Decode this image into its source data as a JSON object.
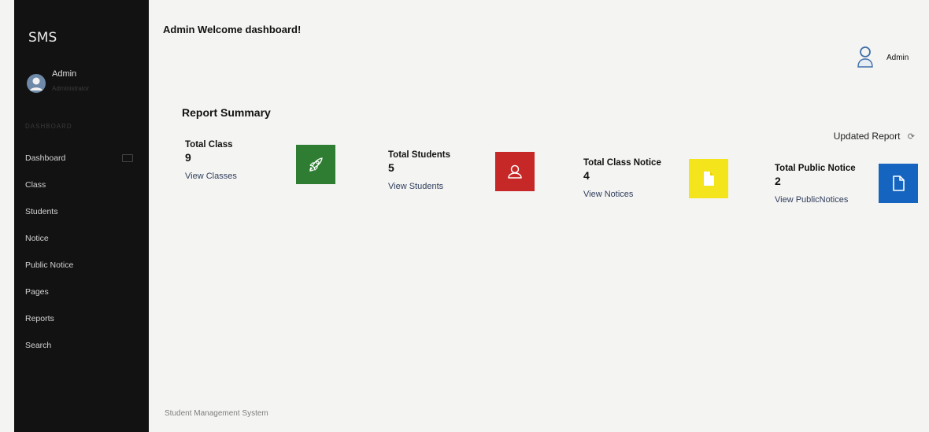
{
  "sidebar": {
    "brand": "SMS",
    "user": {
      "name": "Admin",
      "subtitle": "Administrator"
    },
    "section_label": "DASHBOARD",
    "items": [
      {
        "label": "Dashboard",
        "icon": "monitor-icon"
      },
      {
        "label": "Class"
      },
      {
        "label": "Students"
      },
      {
        "label": "Notice"
      },
      {
        "label": "Public Notice"
      },
      {
        "label": "Pages"
      },
      {
        "label": "Reports"
      },
      {
        "label": "Search"
      }
    ]
  },
  "header": {
    "title": "Admin Welcome dashboard!",
    "user_name": "Admin"
  },
  "main": {
    "report_summary": "Report Summary",
    "updated_report": "Updated Report",
    "cards": [
      {
        "title": "Total Class",
        "value": "9",
        "link": "View Classes",
        "color": "#2e7d32",
        "icon": "rocket-icon"
      },
      {
        "title": "Total Students",
        "value": "5",
        "link": "View Students",
        "color": "#c62828",
        "icon": "user-icon"
      },
      {
        "title": "Total Class Notice",
        "value": "4",
        "link": "View Notices",
        "color": "#f4e41c",
        "icon": "document-icon"
      },
      {
        "title": "Total Public Notice",
        "value": "2",
        "link": "View PublicNotices",
        "color": "#1565c0",
        "icon": "document-icon"
      }
    ]
  },
  "footer": {
    "text": "Student Management System"
  }
}
